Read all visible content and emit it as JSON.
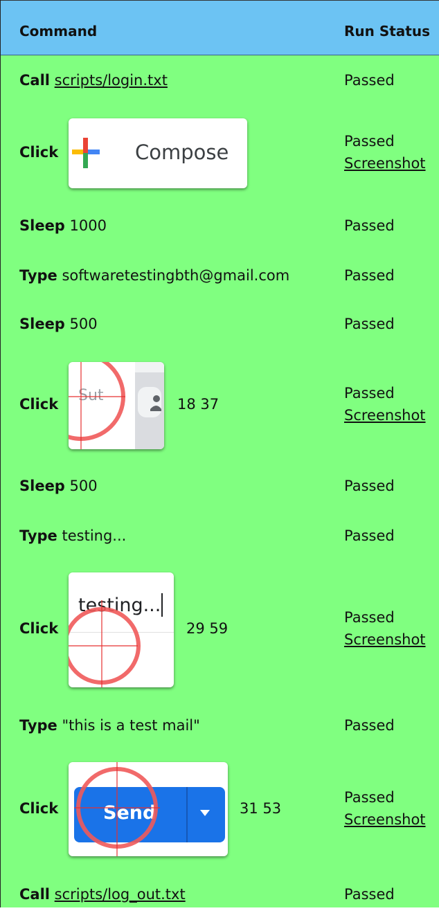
{
  "header": {
    "command": "Command",
    "run_status": "Run Status"
  },
  "rows": [
    {
      "keyword": "Call",
      "arg": "scripts/login.txt",
      "status": "Passed"
    },
    {
      "keyword": "Click",
      "thumb_text": "Compose",
      "status": "Passed",
      "screenshot": "Screenshot"
    },
    {
      "keyword": "Sleep",
      "arg": "1000",
      "status": "Passed"
    },
    {
      "keyword": "Type",
      "arg": "softwaretestingbth@gmail.com",
      "status": "Passed"
    },
    {
      "keyword": "Sleep",
      "arg": "500",
      "status": "Passed"
    },
    {
      "keyword": "Click",
      "thumb_text": "Sut",
      "coords": "18 37",
      "status": "Passed",
      "screenshot": "Screenshot"
    },
    {
      "keyword": "Sleep",
      "arg": "500",
      "status": "Passed"
    },
    {
      "keyword": "Type",
      "arg": "testing...",
      "status": "Passed"
    },
    {
      "keyword": "Click",
      "thumb_text": "testing...",
      "coords": "29 59",
      "status": "Passed",
      "screenshot": "Screenshot"
    },
    {
      "keyword": "Type",
      "arg": "\"this is a test mail\"",
      "status": "Passed"
    },
    {
      "keyword": "Click",
      "thumb_text": "Send",
      "coords": "31 53",
      "status": "Passed",
      "screenshot": "Screenshot"
    },
    {
      "keyword": "Call",
      "arg": "scripts/log_out.txt",
      "status": "Passed"
    }
  ],
  "colors": {
    "header": "#6cc3f3",
    "pass_background": "#80ff80",
    "target_marker": "#f05a5a",
    "send_button": "#1a73e8"
  },
  "icons": {
    "compose": "google-plus-icon",
    "contact": "person-icon",
    "send_menu": "caret-down-icon"
  }
}
